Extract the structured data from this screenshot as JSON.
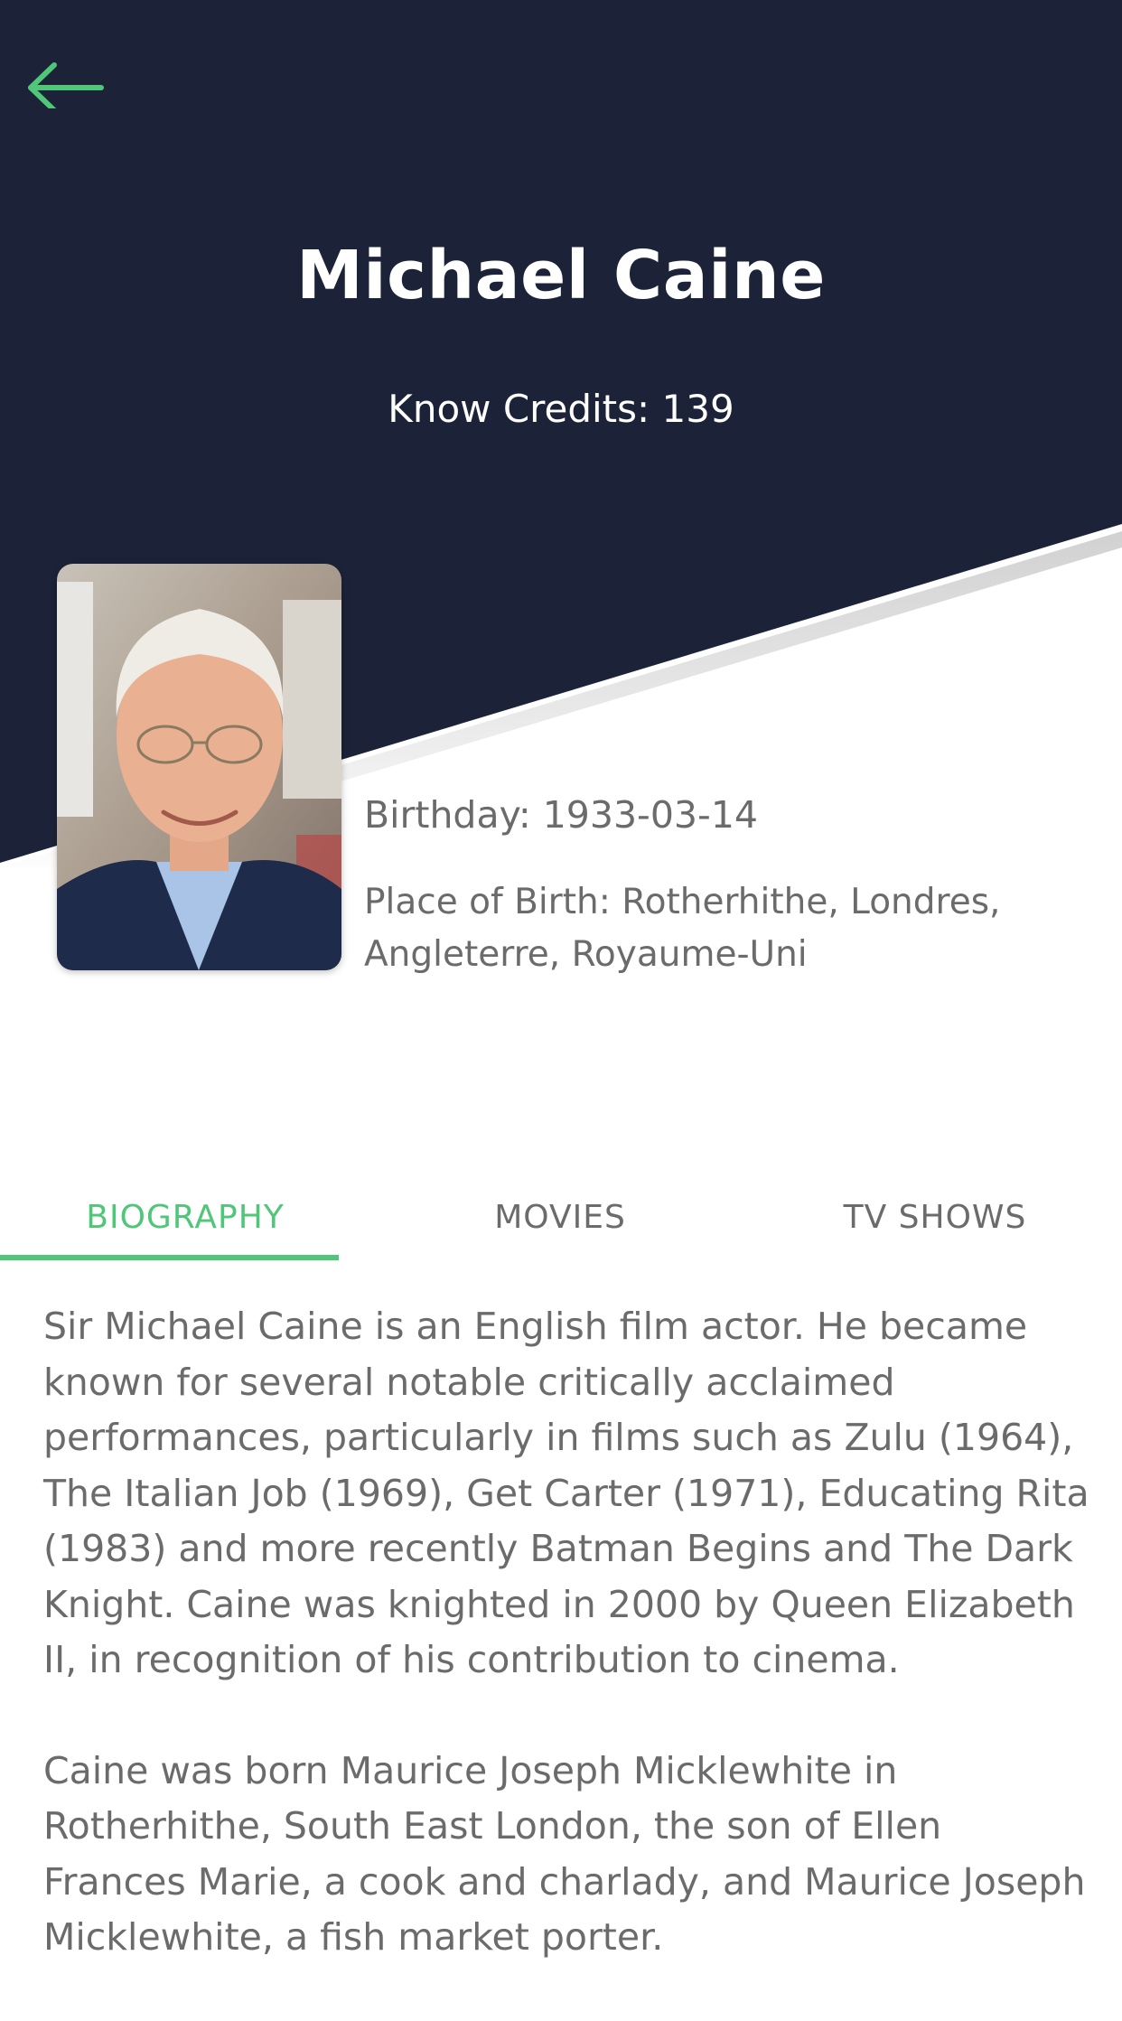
{
  "colors": {
    "header_background": "#1c2339",
    "accent": "#4fc678",
    "body_text": "#6b6b6b",
    "title_text": "#ffffff"
  },
  "nav": {
    "back_icon": "arrow-left-icon"
  },
  "person": {
    "name": "Michael Caine",
    "credits": "Know Credits: 139",
    "birthday": "Birthday: 1933-03-14",
    "place_of_birth": "Place of Birth: Rotherhithe, Londres, Angleterre, Royaume-Uni"
  },
  "tabs": [
    {
      "label": "BIOGRAPHY",
      "active": true
    },
    {
      "label": "MOVIES",
      "active": false
    },
    {
      "label": "TV SHOWS",
      "active": false
    }
  ],
  "biography": {
    "paragraphs": [
      "Sir Michael Caine is an English film actor. He became known for several notable critically acclaimed performances, particularly in films such as Zulu (1964), The Italian Job (1969), Get Carter (1971), Educating Rita (1983) and more recently Batman Begins and The Dark Knight. Caine was knighted in 2000 by Queen Elizabeth II, in recognition of his contribution to cinema.",
      "Caine was born Maurice Joseph Micklewhite in Rotherhithe, South East London, the son of Ellen Frances Marie, a cook and charlady, and Maurice Joseph Micklewhite, a fish market porter."
    ]
  }
}
